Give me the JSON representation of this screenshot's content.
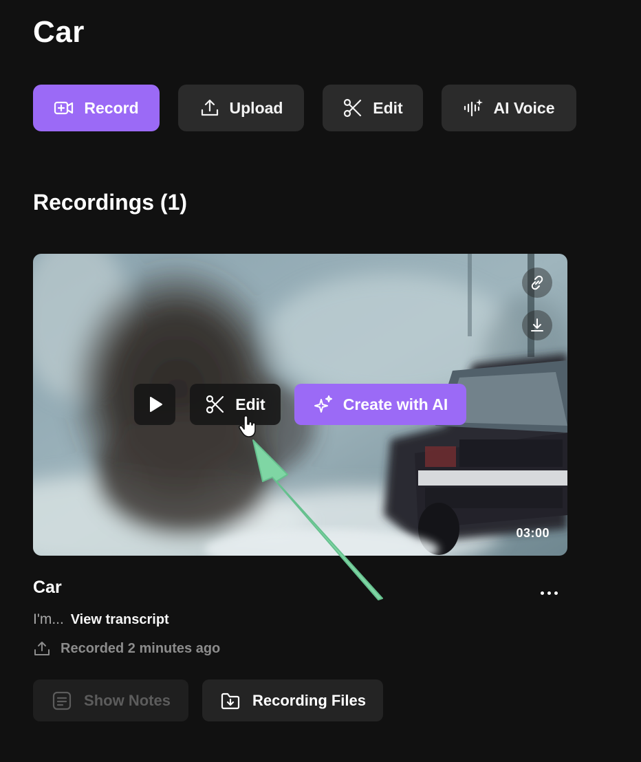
{
  "page": {
    "title": "Car"
  },
  "toolbar": {
    "record_label": "Record",
    "upload_label": "Upload",
    "edit_label": "Edit",
    "ai_voice_label": "AI Voice"
  },
  "recordings": {
    "heading": "Recordings (1)",
    "items": [
      {
        "name": "Car",
        "duration": "03:00",
        "transcript_snippet": "I'm...",
        "view_transcript_label": "View transcript",
        "recorded_time": "Recorded 2 minutes ago",
        "overlay": {
          "edit_label": "Edit",
          "create_ai_label": "Create with AI"
        },
        "actions": {
          "show_notes_label": "Show Notes",
          "recording_files_label": "Recording Files"
        }
      }
    ]
  },
  "colors": {
    "accent": "#9b6af6",
    "background": "#111111",
    "button": "#2b2b2b",
    "annotation_arrow": "#7fd6a4"
  }
}
